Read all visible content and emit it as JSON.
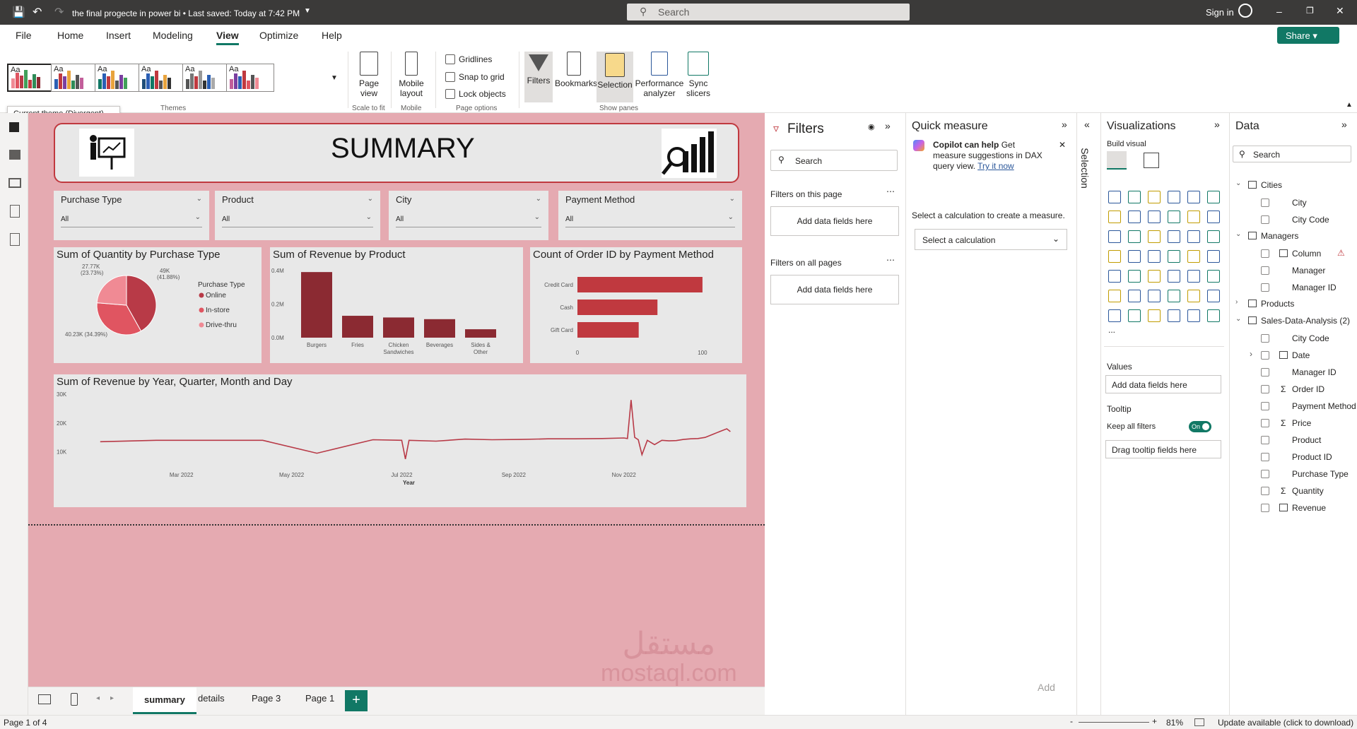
{
  "titlebar": {
    "title": "the final progecte in power bi • Last saved: Today at 7:42 PM",
    "search_placeholder": "Search",
    "sign_in": "Sign in"
  },
  "ribbon_tabs": [
    "File",
    "Home",
    "Insert",
    "Modeling",
    "View",
    "Optimize",
    "Help"
  ],
  "active_tab": "View",
  "share_label": "Share",
  "ribbon": {
    "themes_label": "Themes",
    "theme_thumb_text": "Aa",
    "current_theme_tooltip": "Current theme (Divergent)",
    "page_view": "Page view",
    "scale_to_fit": "Scale to fit",
    "mobile_layout": "Mobile layout",
    "mobile": "Mobile",
    "gridlines": "Gridlines",
    "snap_to_grid": "Snap to grid",
    "lock_objects": "Lock objects",
    "page_options": "Page options",
    "filters": "Filters",
    "bookmarks": "Bookmarks",
    "selection": "Selection",
    "performance_analyzer": "Performance analyzer",
    "sync_slicers": "Sync slicers",
    "show_panes": "Show panes"
  },
  "report": {
    "header_title": "SUMMARY",
    "slicers": [
      {
        "label": "Purchase Type",
        "value": "All"
      },
      {
        "label": "Product",
        "value": "All"
      },
      {
        "label": "City",
        "value": "All"
      },
      {
        "label": "Payment Method",
        "value": "All"
      }
    ],
    "pie": {
      "title": "Sum of Quantity by Purchase Type",
      "legend_title": "Purchase Type",
      "labels": [
        "27.77K (23.73%)",
        "49K (41.88%)",
        "40.23K (34.39%)"
      ]
    },
    "bar": {
      "title": "Sum of Revenue by Product",
      "y_ticks": [
        "0.4M",
        "0.2M",
        "0.0M"
      ],
      "cat_labels": [
        "Burgers",
        "Fries",
        "Chicken Sandwiches",
        "Beverages",
        "Sides & Other"
      ]
    },
    "hbar": {
      "title": "Count of Order ID by Payment Method",
      "x_ticks": [
        "0",
        "100"
      ]
    },
    "line": {
      "title": "Sum of Revenue by Year, Quarter, Month and Day",
      "y_ticks": [
        "30K",
        "20K",
        "10K"
      ],
      "x_ticks": [
        "Mar 2022",
        "May 2022",
        "Jul 2022",
        "Sep 2022",
        "Nov 2022"
      ],
      "x_label": "Year"
    }
  },
  "chart_data": [
    {
      "type": "pie",
      "title": "Sum of Quantity by Purchase Type",
      "legend_title": "Purchase Type",
      "categories": [
        "Online",
        "In-store",
        "Drive-thru"
      ],
      "values": [
        49000,
        40230,
        27770
      ],
      "percents": [
        41.88,
        34.39,
        23.73
      ],
      "colors": [
        "#b83a47",
        "#e05561",
        "#f08a94"
      ],
      "legend_position": "right"
    },
    {
      "type": "bar",
      "title": "Sum of Revenue by Product",
      "categories": [
        "Burgers",
        "Fries",
        "Chicken Sandwiches",
        "Beverages",
        "Sides & Other"
      ],
      "values": [
        0.39,
        0.13,
        0.12,
        0.11,
        0.05
      ],
      "units": "M",
      "ylim": [
        0,
        0.42
      ],
      "color": "#8b2a32"
    },
    {
      "type": "bar",
      "orientation": "horizontal",
      "title": "Count of Order ID by Payment Method",
      "categories": [
        "Credit Card",
        "Cash",
        "Gift Card"
      ],
      "values": [
        100,
        64,
        49
      ],
      "xlim": [
        0,
        130
      ],
      "color": "#c0393f"
    },
    {
      "type": "line",
      "title": "Sum of Revenue by Year, Quarter, Month and Day",
      "xlabel": "Year",
      "ylim": [
        5000,
        30000
      ],
      "color": "#b83a47",
      "x": [
        "2022-01-15",
        "2022-02-15",
        "2022-03-15",
        "2022-04-15",
        "2022-05-15",
        "2022-06-15",
        "2022-07-01",
        "2022-07-03",
        "2022-07-05",
        "2022-07-20",
        "2022-08-05",
        "2022-08-20",
        "2022-09-05",
        "2022-09-20",
        "2022-10-05",
        "2022-10-20",
        "2022-11-01",
        "2022-11-03",
        "2022-11-05",
        "2022-11-07",
        "2022-11-09",
        "2022-11-11",
        "2022-11-14",
        "2022-11-18",
        "2022-11-22",
        "2022-11-26",
        "2022-11-30",
        "2022-12-04",
        "2022-12-08",
        "2022-12-12",
        "2022-12-16",
        "2022-12-20",
        "2022-12-24",
        "2022-12-28",
        "2022-12-30"
      ],
      "y": [
        13500,
        14000,
        14000,
        14000,
        9500,
        14200,
        14000,
        7500,
        14000,
        13700,
        14400,
        14200,
        14300,
        14500,
        14500,
        14600,
        14800,
        14600,
        28000,
        15000,
        14200,
        9000,
        14000,
        12500,
        14000,
        13800,
        13900,
        14300,
        14500,
        14600,
        15000,
        16000,
        17000,
        18000,
        17000
      ]
    }
  ],
  "bottom_tabs": [
    "summary",
    "details",
    "Page 3",
    "Page 1"
  ],
  "active_page": "summary",
  "status": {
    "page": "Page 1 of 4",
    "zoom": "81%",
    "update": "Update available (click to download)"
  },
  "filters_pane": {
    "title": "Filters",
    "search": "Search",
    "on_this_page": "Filters on this page",
    "on_all_pages": "Filters on all pages",
    "add_fields": "Add data fields here"
  },
  "quick_measure": {
    "title": "Quick measure",
    "copilot_bold": "Copilot can help",
    "copilot_text": "Get measure suggestions in DAX query view.",
    "try_it": "Try it now",
    "select_calc_text": "Select a calculation to create a measure.",
    "select_placeholder": "Select a calculation",
    "add": "Add"
  },
  "selection_rail": "Selection",
  "viz_pane": {
    "title": "Visualizations",
    "build_visual": "Build visual",
    "values": "Values",
    "add_fields": "Add data fields here",
    "tooltip": "Tooltip",
    "keep_filters": "Keep all filters",
    "toggle": "On",
    "drag_tooltip": "Drag tooltip fields here",
    "more": "..."
  },
  "data_pane": {
    "title": "Data",
    "search": "Search",
    "tables": [
      {
        "name": "Cities",
        "fields": [
          "City",
          "City Code"
        ]
      },
      {
        "name": "Managers",
        "fields": [
          "Column",
          "Manager",
          "Manager ID"
        ]
      },
      {
        "name": "Products",
        "fields": []
      },
      {
        "name": "Sales-Data-Analysis (2)",
        "fields": [
          "City Code",
          "Date",
          "Manager ID",
          "Order ID",
          "Payment Method",
          "Price",
          "Product",
          "Product ID",
          "Purchase Type",
          "Quantity",
          "Revenue"
        ]
      }
    ]
  },
  "watermark": {
    "line1": "مستقل",
    "line2": "mostaql.com"
  }
}
